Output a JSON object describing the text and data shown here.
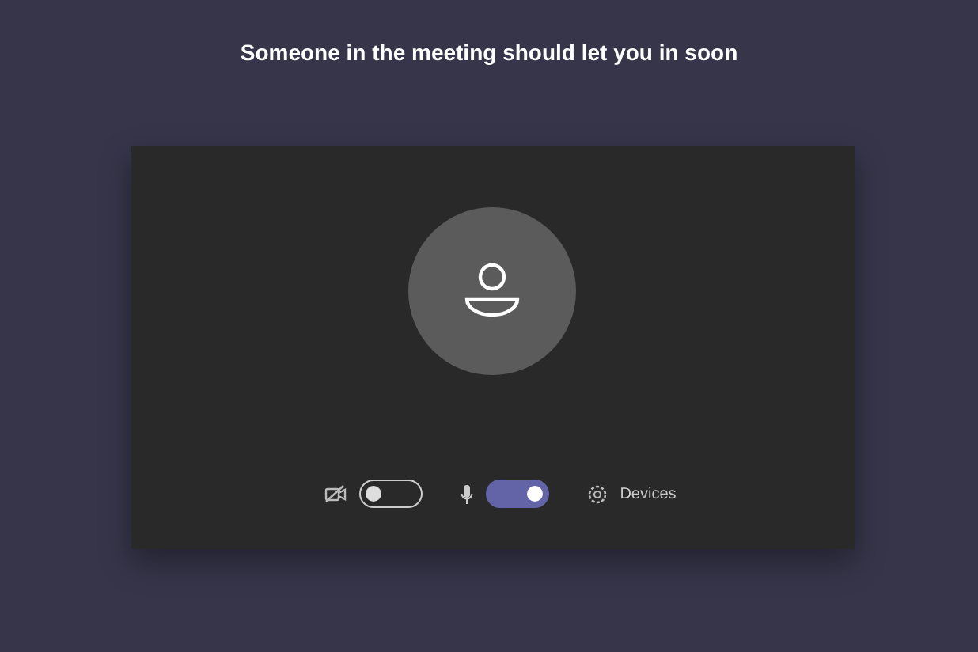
{
  "title": "Someone in the meeting should let you in soon",
  "controls": [
    {
      "kind": "camera",
      "on": false
    },
    {
      "kind": "mic",
      "on": true
    },
    {
      "kind": "devices",
      "label": "Devices"
    }
  ]
}
